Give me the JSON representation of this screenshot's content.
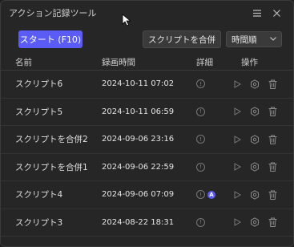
{
  "window": {
    "title": "アクション記録ツール"
  },
  "toolbar": {
    "start_label": "スタート (F10)",
    "merge_label": "スクリプトを合併",
    "sort_selected": "時間順"
  },
  "table": {
    "headers": [
      "名前",
      "録画時間",
      "詳細",
      "操作"
    ],
    "rows": [
      {
        "name": "スクリプト6",
        "time": "2024-10-11 07:02",
        "badge": ""
      },
      {
        "name": "スクリプト5",
        "time": "2024-10-11 06:59",
        "badge": ""
      },
      {
        "name": "スクリプトを合併2",
        "time": "2024-09-06 23:16",
        "badge": ""
      },
      {
        "name": "スクリプトを合併1",
        "time": "2024-09-06 22:59",
        "badge": ""
      },
      {
        "name": "スクリプト4",
        "time": "2024-09-06 07:09",
        "badge": "A"
      },
      {
        "name": "スクリプト3",
        "time": "2024-08-22 18:31",
        "badge": ""
      }
    ]
  },
  "colors": {
    "accent": "#5b5bf5",
    "background": "#262626"
  },
  "icons": {
    "menu": "hamburger-icon",
    "close": "close-icon",
    "info": "info-icon",
    "play": "play-icon",
    "settings": "settings-icon",
    "delete": "trash-icon"
  }
}
